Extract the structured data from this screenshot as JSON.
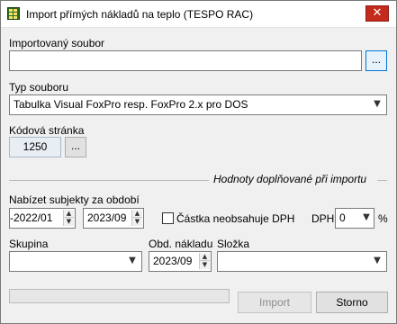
{
  "window": {
    "title": "Import přímých nákladů na teplo (TESPO RAC)",
    "close_glyph": "✕"
  },
  "source_file": {
    "label": "Importovaný soubor",
    "value": "",
    "browse_label": "..."
  },
  "file_type": {
    "label": "Typ souboru",
    "value": "Tabulka Visual FoxPro resp. FoxPro 2.x pro DOS"
  },
  "code_page": {
    "label": "Kódová stránka",
    "value": "1250",
    "button_label": "..."
  },
  "import_section": {
    "heading": "Hodnoty doplňované při importu"
  },
  "period": {
    "label": "Nabízet subjekty za období",
    "from": "-2022/01",
    "to": "2023/09"
  },
  "vat": {
    "checkbox_label": "Částka neobsahuje DPH",
    "checked": false,
    "dph_label": "DPH",
    "dph_value": "0",
    "percent_label": "%"
  },
  "group": {
    "label": "Skupina",
    "value": ""
  },
  "cost_period": {
    "label": "Obd. nákladu",
    "value": "2023/09"
  },
  "component": {
    "label": "Složka",
    "value": ""
  },
  "progress": {
    "value": 0
  },
  "actions": {
    "import_label": "Import",
    "cancel_label": "Storno"
  }
}
